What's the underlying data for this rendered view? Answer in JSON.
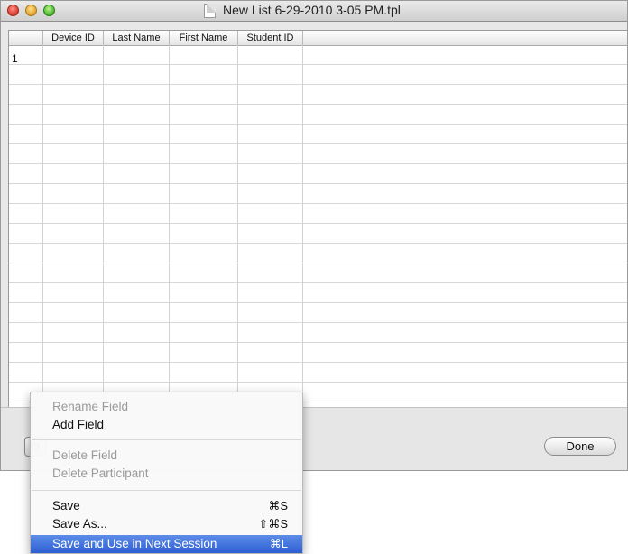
{
  "window": {
    "title": "New List 6-29-2010 3-05 PM.tpl"
  },
  "table": {
    "columns": [
      "Device ID",
      "Last Name",
      "First Name",
      "Student ID"
    ],
    "rows": [
      [
        "1",
        "",
        "",
        ""
      ]
    ]
  },
  "bottombar": {
    "done_label": "Done",
    "gear_icon": "gear-icon"
  },
  "menu": {
    "items": [
      {
        "label": "Rename Field",
        "enabled": false,
        "shortcut": ""
      },
      {
        "label": "Add Field",
        "enabled": true,
        "shortcut": ""
      },
      {
        "label": "Delete Field",
        "enabled": false,
        "shortcut": ""
      },
      {
        "label": "Delete Participant",
        "enabled": false,
        "shortcut": ""
      },
      {
        "label": "Save",
        "enabled": true,
        "shortcut": "⌘S"
      },
      {
        "label": "Save As...",
        "enabled": true,
        "shortcut": "⇧⌘S"
      },
      {
        "label": "Save and Use in Next Session",
        "enabled": true,
        "shortcut": "⌘L",
        "highlighted": true
      }
    ]
  },
  "colors": {
    "highlight": "#2d5fd2",
    "disabled_text": "#9a9a9a"
  }
}
